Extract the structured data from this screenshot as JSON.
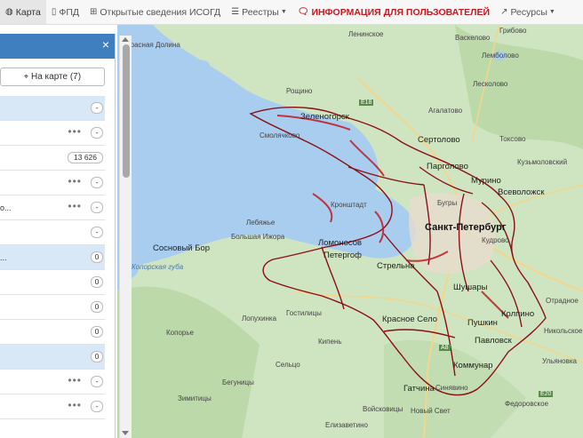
{
  "nav": {
    "items": [
      {
        "label": "Карта",
        "icon": "globe-icon",
        "active": true
      },
      {
        "label": "ФПД",
        "icon": "map-icon"
      },
      {
        "label": "Открытые сведения ИСОГД",
        "icon": "grid-icon"
      },
      {
        "label": "Реестры",
        "icon": "list-icon",
        "dropdown": true
      },
      {
        "label": "ИНФОРМАЦИЯ ДЛЯ ПОЛЬЗОВАТЕЛЕЙ",
        "icon": "chat-icon"
      },
      {
        "label": "Ресурсы",
        "icon": "external-link-icon",
        "dropdown": true
      }
    ]
  },
  "panel": {
    "close": "×",
    "map_button": "На карте (7)",
    "rows": [
      {
        "label": "",
        "badge": "-",
        "dots": false,
        "hl": true
      },
      {
        "label": "",
        "badge": "-",
        "dots": true,
        "hl": false
      },
      {
        "label": "",
        "badge": "13 626",
        "dots": false,
        "hl": false
      },
      {
        "label": "",
        "badge": "-",
        "dots": true,
        "hl": false
      },
      {
        "label": "о...",
        "badge": "-",
        "dots": true,
        "hl": false
      },
      {
        "label": "",
        "badge": "-",
        "dots": false,
        "hl": false
      },
      {
        "label": "...",
        "badge": "0",
        "dots": false,
        "hl": true
      },
      {
        "label": "",
        "badge": "0",
        "dots": false,
        "hl": false
      },
      {
        "label": "",
        "badge": "0",
        "dots": false,
        "hl": false
      },
      {
        "label": "",
        "badge": "0",
        "dots": false,
        "hl": false
      },
      {
        "label": "",
        "badge": "0",
        "dots": false,
        "hl": true
      },
      {
        "label": "",
        "badge": "-",
        "dots": true,
        "hl": false
      },
      {
        "label": "",
        "badge": "-",
        "dots": true,
        "hl": false
      }
    ]
  },
  "map": {
    "labels": {
      "krasnaya_dolina": "Красная Долина",
      "vyborgsky": "Ленинское",
      "roschino": "Рощино",
      "e18": "E18",
      "zelenogorsk": "Зеленогорск",
      "smolyachkovo": "Смолячково",
      "sertolovo": "Сертолово",
      "pargolovo": "Парголово",
      "murino": "Мурино",
      "vsevolozhsk": "Всеволожск",
      "kronshtadt": "Кронштадт",
      "spb": "Санкт-Петербург",
      "kudrovo": "Кудрово",
      "lebyazhe": "Лебяжье",
      "sosnovy_bor": "Сосновый Бор",
      "bolshaya_izhora": "Большая Ижора",
      "lomonosov": "Ломоносов",
      "peterhof": "Петергоф",
      "strelna": "Стрельна",
      "koporskaya_guba": "Копорская губа",
      "shushary": "Шушары",
      "kolpino": "Колпино",
      "otradnoe": "Отрадное",
      "nikolskoe": "Никольское",
      "krasnoe_selo": "Красное Село",
      "pushkin": "Пушкин",
      "pavlovsk": "Павловск",
      "lopukhinka": "Лопухинка",
      "gostilitsy": "Гостилицы",
      "koporye": "Копорье",
      "kipen": "Кипень",
      "selco": "Сельцо",
      "begunitsy": "Бегуницы",
      "kommunar": "Коммунар",
      "ulyanovka": "Ульяновка",
      "gatchina": "Гатчина",
      "zimititsy": "Зимитицы",
      "voyskovitsy": "Войсковицы",
      "novy_svet": "Новый Свет",
      "elizavetino": "Елизаветино",
      "fedorovskoe": "Федоровское",
      "toksovo": "Токсово",
      "agalatovo": "Агалатово",
      "lesnolovo": "Лесколово",
      "vaskelovo": "Васкелово",
      "grbovo": "Грибово",
      "lembolovo": "Лемболово",
      "bugry": "Бугры",
      "kuzmolovsky": "Кузьмоловский",
      "sinyavino": "Синявино",
      "e20": "E20",
      "a8": "А8"
    }
  },
  "colors": {
    "nav_alert": "#c9181e",
    "panel_header": "#3f7fc0",
    "water": "#a9cdef",
    "land": "#c6e0b8",
    "boundary": "#8b0f16"
  }
}
